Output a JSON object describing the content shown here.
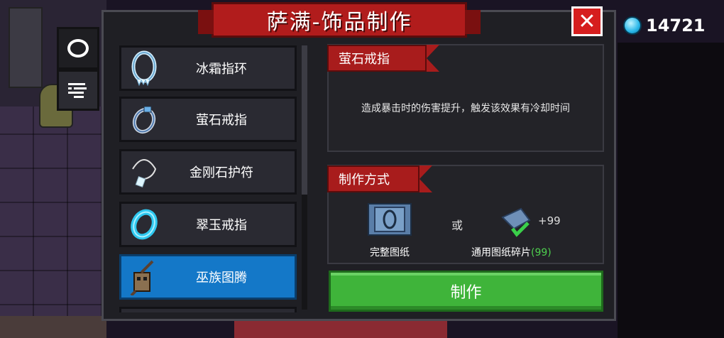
{
  "header": {
    "title": "萨满-饰品制作",
    "close_label": "✕",
    "currency_value": "14721"
  },
  "side_tabs": [
    {
      "name": "ring-tab"
    },
    {
      "name": "list-tab",
      "glyph": "☰"
    }
  ],
  "items": [
    {
      "label": "冰霜指环",
      "icon": "frost-ring-icon"
    },
    {
      "label": "萤石戒指",
      "icon": "fluorite-ring-icon"
    },
    {
      "label": "金刚石护符",
      "icon": "diamond-amulet-icon"
    },
    {
      "label": "翠玉戒指",
      "icon": "jade-ring-icon"
    },
    {
      "label": "巫族图腾",
      "icon": "witch-totem-icon",
      "selected": true
    }
  ],
  "detail": {
    "name": "萤石戒指",
    "description": "造成暴击时的伤害提升，触发该效果有冷却时间"
  },
  "method": {
    "heading": "制作方式",
    "full_label": "完整图纸",
    "or_text": "或",
    "fragment_count": "+99",
    "fragment_label": "通用图纸碎片",
    "fragment_owned": "(99)"
  },
  "craft_label": "制作",
  "colors": {
    "accent_red": "#b11c1c",
    "selected_blue": "#1478c8",
    "craft_green": "#3fb43a",
    "owned_green": "#4ed04e"
  }
}
